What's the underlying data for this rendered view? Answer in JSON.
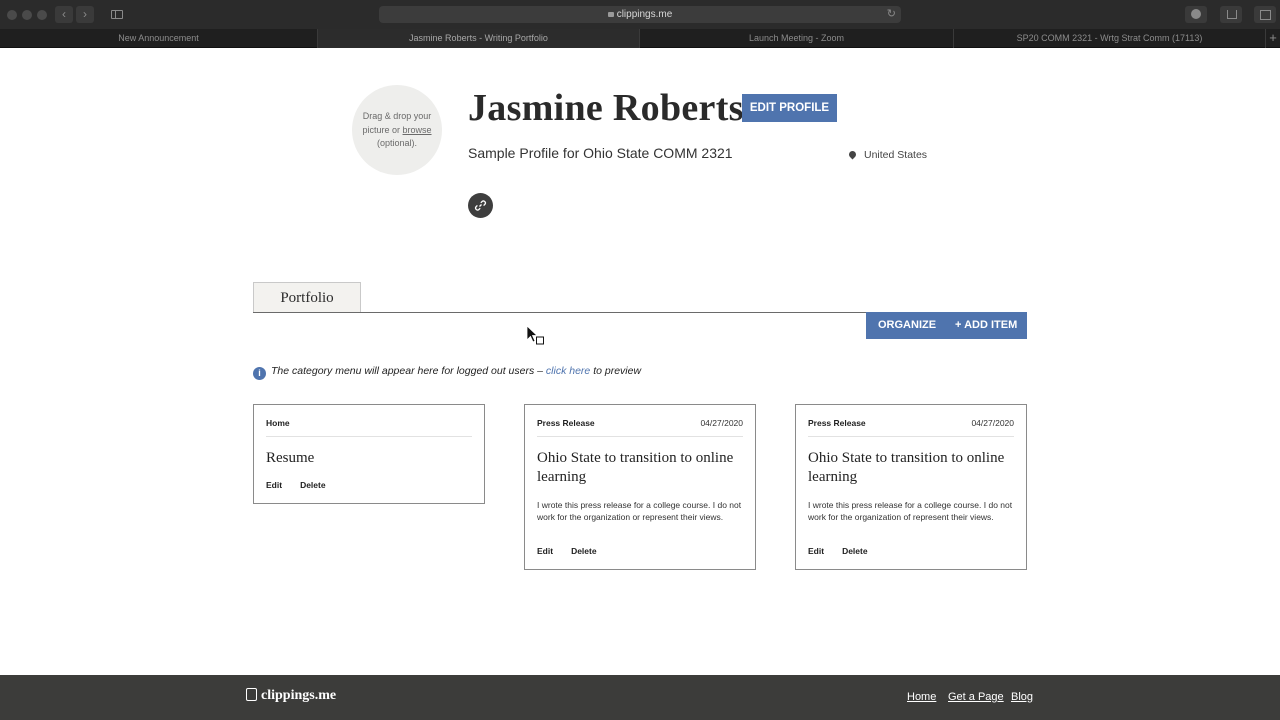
{
  "browser": {
    "url": "clippings.me",
    "tabs": [
      {
        "label": "New Announcement"
      },
      {
        "label": "Jasmine Roberts - Writing Portfolio"
      },
      {
        "label": "Launch Meeting - Zoom"
      },
      {
        "label": "SP20 COMM 2321 - Wrtg Strat Comm (17113)"
      }
    ],
    "new_tab": "+"
  },
  "profile": {
    "avatar_text_1": "Drag & drop your",
    "avatar_text_2": "picture or",
    "avatar_browse": "browse",
    "avatar_text_3": "(optional).",
    "name": "Jasmine Roberts",
    "edit_button": "EDIT PROFILE",
    "subtitle": "Sample Profile for Ohio State COMM 2321",
    "location": "United States",
    "link_icon": "link-icon"
  },
  "portfolio": {
    "tab_label": "Portfolio",
    "organize": "ORGANIZE",
    "add_item": "+ ADD ITEM",
    "info_text": "The category menu will appear here for logged out users –",
    "info_link": "click here",
    "info_suffix": "to preview"
  },
  "cards": [
    {
      "category": "Home",
      "date": "",
      "title": "Resume",
      "description": "",
      "edit": "Edit",
      "delete": "Delete"
    },
    {
      "category": "Press Release",
      "date": "04/27/2020",
      "title": "Ohio State to transition to online learning",
      "description": "I wrote this press release for a college course. I do not work for the organization or represent their views.",
      "edit": "Edit",
      "delete": "Delete"
    },
    {
      "category": "Press Release",
      "date": "04/27/2020",
      "title": "Ohio State to transition to online learning",
      "description": "I wrote this press release for a college course. I do not work for the organization of represent their views.",
      "edit": "Edit",
      "delete": "Delete"
    }
  ],
  "footer": {
    "logo": "clippings.me",
    "links": [
      "Home",
      "Get a Page",
      "Blog"
    ]
  },
  "colors": {
    "accent": "#4f74ae",
    "footer_bg": "#3c3c3a"
  }
}
